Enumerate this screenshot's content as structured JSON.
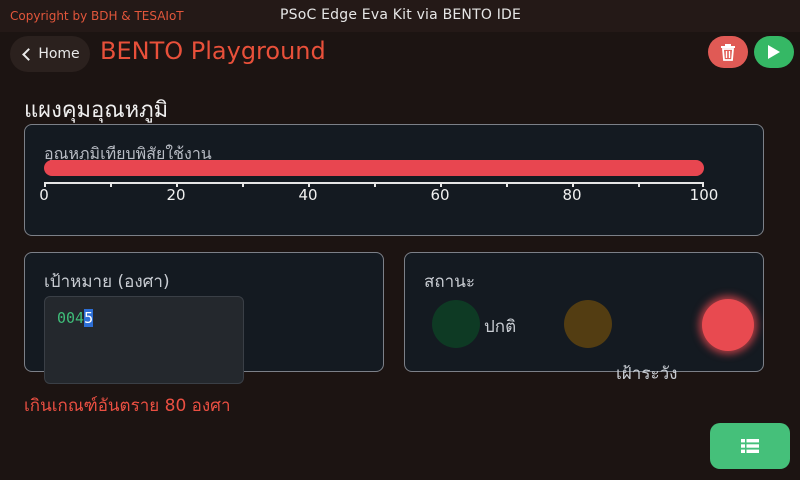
{
  "header": {
    "copyright": "Copyright by BDH & TESAIoT",
    "device_title": "PSoC Edge Eva Kit via BENTO IDE"
  },
  "nav": {
    "home_label": "Home",
    "app_title": "BENTO Playground",
    "home_icon": "chevron-left-icon",
    "trash_icon": "trash-icon",
    "run_icon": "play-icon"
  },
  "page": {
    "heading": "แผงคุมอุณหภูมิ"
  },
  "temperature": {
    "label": "อุณหภูมิเทียบพิสัยใช้งาน",
    "value": 100,
    "min": 0,
    "max": 100,
    "tick_labels": [
      "0",
      "20",
      "40",
      "60",
      "80",
      "100"
    ]
  },
  "target": {
    "label": "เป้าหมาย (องศา)",
    "value_prefix": "004",
    "value_selected": "5"
  },
  "status": {
    "label": "สถานะ",
    "normal_label": "ปกติ",
    "warning_label": "เฝ้าระวัง",
    "active": "danger"
  },
  "alert": {
    "text": "เกินเกณฑ์อันตราย 80 องศา"
  },
  "colors": {
    "accent": "#e8503a",
    "bar": "#e84650",
    "ok": "#35b865",
    "danger": "#e84a50"
  },
  "fab": {
    "icon": "list-icon"
  }
}
